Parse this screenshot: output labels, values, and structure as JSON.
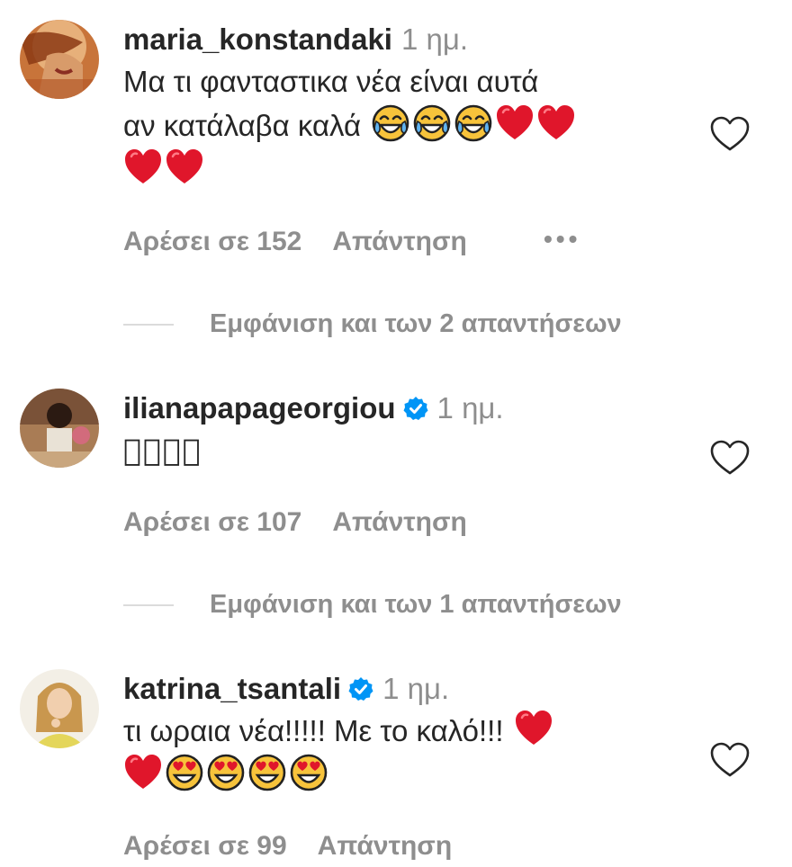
{
  "comments": [
    {
      "username": "maria_konstandaki",
      "time": "1 ημ.",
      "verified": false,
      "text_line1": "Μα τι φανταστικα νέα είναι αυτά",
      "text_line2": "αν κατάλαβα καλά",
      "emojis_line2": [
        "tears-of-joy-emoji",
        "tears-of-joy-emoji",
        "tears-of-joy-emoji",
        "red-heart-emoji",
        "red-heart-emoji"
      ],
      "emojis_line3": [
        "red-heart-emoji",
        "red-heart-emoji"
      ],
      "likes": "Αρέσει σε 152",
      "reply": "Απάντηση",
      "more": "•••",
      "view_replies": "Εμφάνιση και των 2 απαντήσεων"
    },
    {
      "username": "ilianapapageorgiou",
      "time": "1 ημ.",
      "verified": true,
      "text_line1": "􀀀􀀀􀀀􀀀",
      "likes": "Αρέσει σε 107",
      "reply": "Απάντηση",
      "view_replies": "Εμφάνιση και των 1 απαντήσεων"
    },
    {
      "username": "katrina_tsantali",
      "time": "1 ημ.",
      "verified": true,
      "text_line1": "τι ωραια νέα!!!!! Με το καλό!!!",
      "emojis_line1": [
        "red-heart-emoji"
      ],
      "emojis_line2": [
        "red-heart-emoji",
        "heart-eyes-emoji",
        "heart-eyes-emoji",
        "heart-eyes-emoji",
        "heart-eyes-emoji"
      ],
      "likes": "Αρέσει σε 99",
      "reply": "Απάντηση"
    }
  ],
  "colors": {
    "text": "#262626",
    "muted": "#8e8e8e",
    "verified": "#0095f6",
    "heart": "#e0162b",
    "emoji_yellow": "#f7c33b"
  }
}
